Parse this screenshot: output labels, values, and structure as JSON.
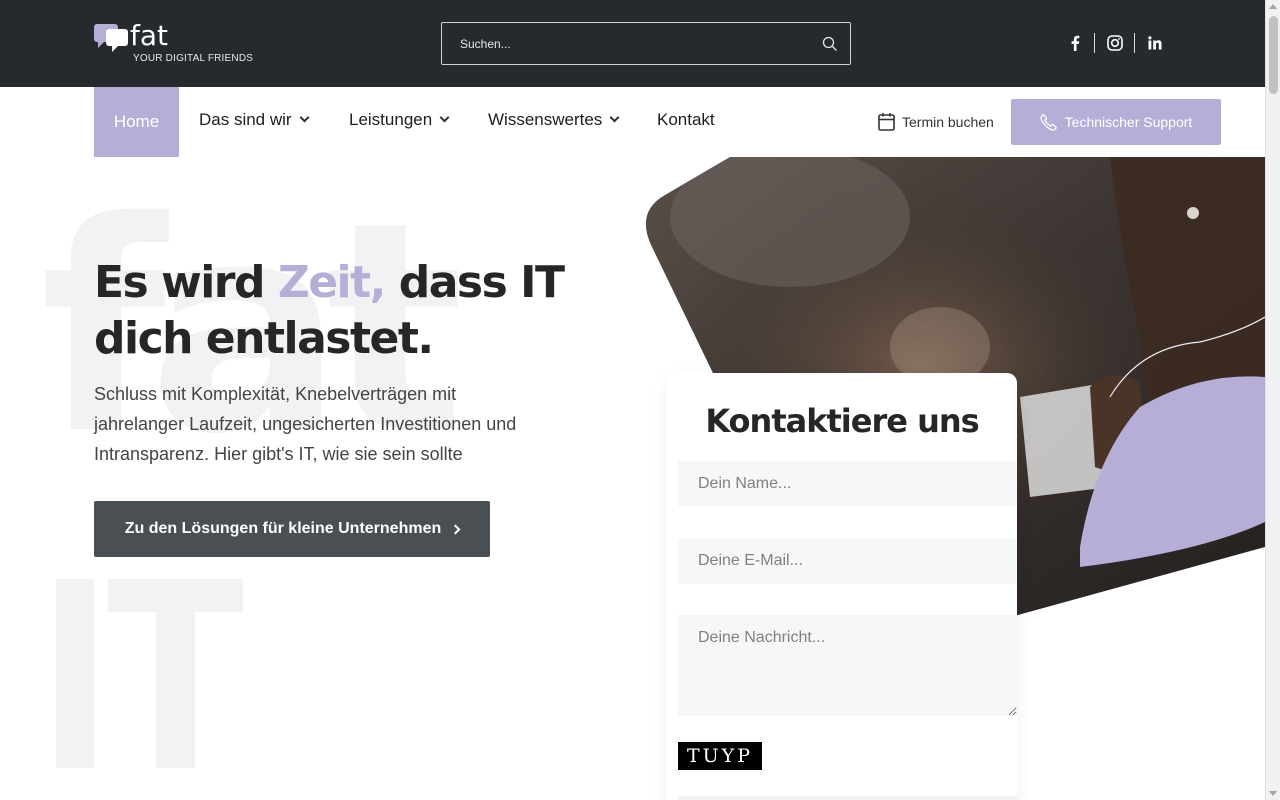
{
  "header": {
    "logo_word": "fat",
    "logo_tagline": "YOUR DIGITAL FRIENDS",
    "search_placeholder": "Suchen...",
    "social": [
      "facebook-icon",
      "instagram-icon",
      "linkedin-icon"
    ]
  },
  "nav": {
    "items": [
      {
        "label": "Home",
        "active": true
      },
      {
        "label": "Das sind wir",
        "dropdown": true
      },
      {
        "label": "Leistungen",
        "dropdown": true
      },
      {
        "label": "Wissenswertes",
        "dropdown": true
      },
      {
        "label": "Kontakt",
        "dropdown": false
      }
    ],
    "termin_label": "Termin buchen",
    "support_label": "Technischer Support"
  },
  "hero": {
    "title_part1": "Es wird ",
    "title_accent": "Zeit,",
    "title_part2": " dass IT dich entlastet.",
    "subtitle": "Schluss mit Komplexität, Knebelverträgen mit jahrelanger Laufzeit, ungesicherten Investitionen und Intransparenz. Hier gibt's IT, wie sie sein sollte",
    "cta_label": "Zu den Lösungen für kleine Unternehmen",
    "watermark_top": "fat",
    "watermark_bottom": "IT"
  },
  "contact_form": {
    "title": "Kontaktiere uns",
    "name_placeholder": "Dein Name...",
    "email_placeholder": "Deine E-Mail...",
    "message_placeholder": "Deine Nachricht...",
    "captcha_text": "TUYP"
  },
  "colors": {
    "topbar": "#262a2e",
    "accent": "#b7aed8",
    "cta": "#4a4f53"
  }
}
